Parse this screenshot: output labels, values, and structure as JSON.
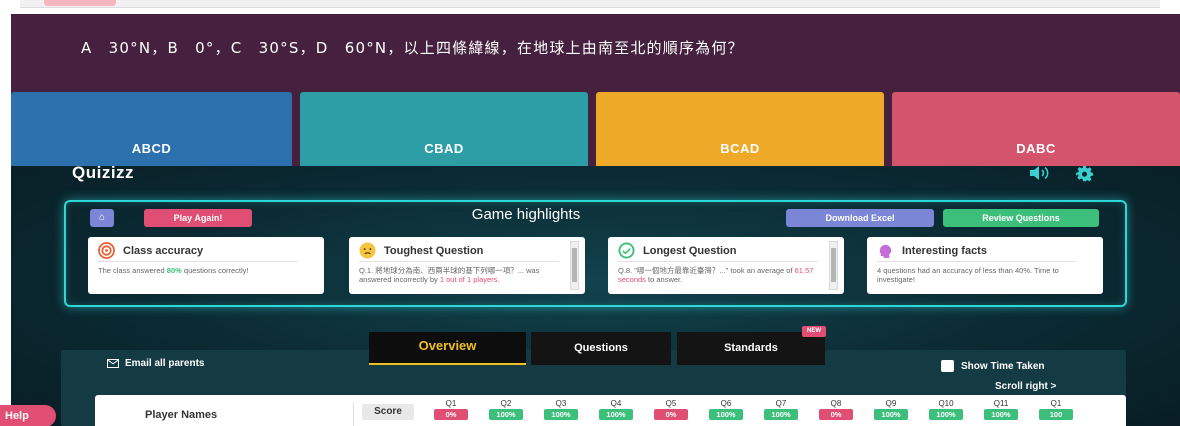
{
  "question": {
    "text": "A　30°N，B　0°，C　30°S，D　60°N，以上四條緯線，在地球上由南至北的順序為何？",
    "options": [
      {
        "label": "ABCD",
        "color": "#2d70ae"
      },
      {
        "label": "CBAD",
        "color": "#2d9da6"
      },
      {
        "label": "BCAD",
        "color": "#efa929"
      },
      {
        "label": "DABC",
        "color": "#d5546d"
      }
    ]
  },
  "report": {
    "logo": "Quizizz",
    "play_again": "Play Again!",
    "highlights_title": "Game highlights",
    "download_excel": "Download Excel",
    "review_questions": "Review Questions",
    "cards": {
      "accuracy": {
        "title": "Class accuracy",
        "body_pre": "The class answered ",
        "body_value": "80%",
        "body_post": " questions correctly!"
      },
      "toughest": {
        "title": "Toughest Question",
        "body_pre": "Q.1. 將地球分為南、西兩半球的基下列哪一項？... was answered incorrectly by ",
        "body_value": "1 out of 1 players",
        "body_post": "."
      },
      "longest": {
        "title": "Longest Question",
        "body_pre": "Q.8. \"哪一個地方最靠近臺灣？...\" took an average of ",
        "body_value": "61.57 seconds",
        "body_post": " to answer."
      },
      "facts": {
        "title": "Interesting facts",
        "body": "4 questions had an accuracy of less than 40%. Time to investigate!"
      }
    },
    "tabs": {
      "overview": "Overview",
      "questions": "Questions",
      "standards": "Standards",
      "new_badge": "NEW"
    },
    "email_all": "Email all parents",
    "show_time": "Show Time Taken",
    "scroll_right": "Scroll right  >",
    "table": {
      "player_names": "Player Names",
      "score": "Score",
      "questions": [
        {
          "name": "Q1",
          "pct": "0%",
          "state": "wrong"
        },
        {
          "name": "Q2",
          "pct": "100%",
          "state": "right"
        },
        {
          "name": "Q3",
          "pct": "100%",
          "state": "right"
        },
        {
          "name": "Q4",
          "pct": "100%",
          "state": "right"
        },
        {
          "name": "Q5",
          "pct": "0%",
          "state": "wrong"
        },
        {
          "name": "Q6",
          "pct": "100%",
          "state": "right"
        },
        {
          "name": "Q7",
          "pct": "100%",
          "state": "right"
        },
        {
          "name": "Q8",
          "pct": "0%",
          "state": "wrong"
        },
        {
          "name": "Q9",
          "pct": "100%",
          "state": "right"
        },
        {
          "name": "Q10",
          "pct": "100%",
          "state": "right"
        },
        {
          "name": "Q11",
          "pct": "100%",
          "state": "right"
        },
        {
          "name": "Q1",
          "pct": "100",
          "state": "right"
        }
      ]
    },
    "colors": {
      "right": "#3dbf7c",
      "wrong": "#e04e73",
      "accent": "#2fd6d6"
    }
  },
  "help": "Help"
}
